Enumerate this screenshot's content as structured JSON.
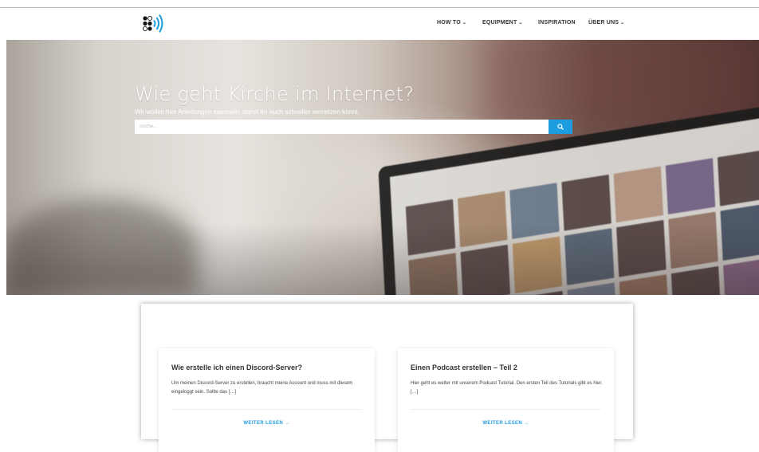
{
  "header": {
    "logo_name": "site-logo",
    "nav": [
      {
        "label": "HOW TO",
        "has_dropdown": true
      },
      {
        "label": "EQUIPMENT",
        "has_dropdown": true
      },
      {
        "label": "INSPIRATION",
        "has_dropdown": false
      },
      {
        "label": "ÜBER UNS",
        "has_dropdown": true
      }
    ],
    "chevron": "⌄"
  },
  "hero": {
    "title": "Wie geht Kirche im Internet?",
    "subtitle": "Wir wollen hier Anleitungen sammeln, damit Ihr euch schneller vernetzen könnt.",
    "search": {
      "placeholder": "Suche...",
      "button_icon": "search-icon"
    }
  },
  "posts": [
    {
      "title": "Wie erstelle ich einen Discord-Server?",
      "excerpt": "Um meinen Discord-Server zu erstellen, braucht meine Account und muss mit diesem eingeloggt sein. Sollte das […]",
      "more_label": "WEITER LESEN →"
    },
    {
      "title": "Einen Podcast erstellen – Teil 2",
      "excerpt": "Hier geht es weiter mit unserem Podcast Tutorial. Den ersten Teil des Tutorials gibt es hier. […]",
      "more_label": "WEITER LESEN →"
    }
  ],
  "colors": {
    "accent": "#1e9ce0",
    "logo_dark": "#111111",
    "logo_blue": "#1e9ce0"
  }
}
